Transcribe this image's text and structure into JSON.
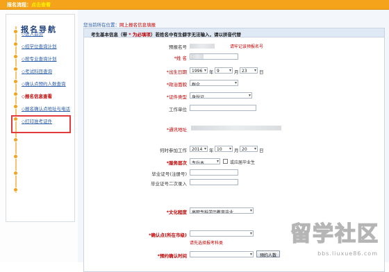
{
  "breadcrumb": {
    "prefix": "报名流程：",
    "current": "点击查看"
  },
  "nav": {
    "title": "报名导航",
    "items": [
      {
        "label": "◇进入首页",
        "active": false
      },
      {
        "label": "◇招学位查询计划",
        "active": false
      },
      {
        "label": "◇按专业查询计划",
        "active": false
      },
      {
        "label": "◇考试科目查询",
        "active": false
      },
      {
        "label": "◇确认点预约人数查询",
        "active": false
      },
      {
        "label": "◇报名信息查看",
        "active": true
      },
      {
        "label": "◇报名确认点地址与电话",
        "active": false
      },
      {
        "label": "◇打印准考证件",
        "active": false
      }
    ]
  },
  "location": {
    "prefix": "您当前所在位置：",
    "current": "网上报名信息填报"
  },
  "form": {
    "header_start": "考生基本信息（带",
    "header_req": " * 为必填项",
    "header_end": "）若姓名中有生僻字无法输入，请以拼音代替",
    "fields": {
      "signup_no_label": "预报名号",
      "signup_no_hint": "请牢记该预报名号",
      "name_label": "*姓  名",
      "birth_label": "*出生日期",
      "birth_year": "1996",
      "birth_month": "9",
      "birth_day": "23",
      "year_unit": "年",
      "month_unit": "月",
      "day_unit": "日",
      "politics_label": "*政治面貌",
      "politics_value": "群众",
      "idtype_label": "*证件类型",
      "idtype_value": "身份证",
      "workunit_label": "工作单位",
      "address_label": "*通讯地址",
      "work_time_label": "何时参加工作",
      "work_year": "2014",
      "work_month": "10",
      "work_day": "20",
      "service_level_label": "*服务层次",
      "service_level_value": "专升本",
      "fresh_grad_label": "或应届毕业生",
      "grad_cert_label": "毕业证号(注册号)",
      "grad_cert_confirm_label": "毕业证号二次录入",
      "education_label": "*文化程度",
      "education_value": "高职专科学历教育毕业",
      "confirm_point_label": "*确认点(所在市级)",
      "confirm_point_hint": "请先选择报考科类",
      "booking_time_label": "*预约确认时间",
      "booking_button": "预约人数"
    }
  },
  "watermark": {
    "brand": "留学社区",
    "url": "bbs.liuxue86.com"
  }
}
